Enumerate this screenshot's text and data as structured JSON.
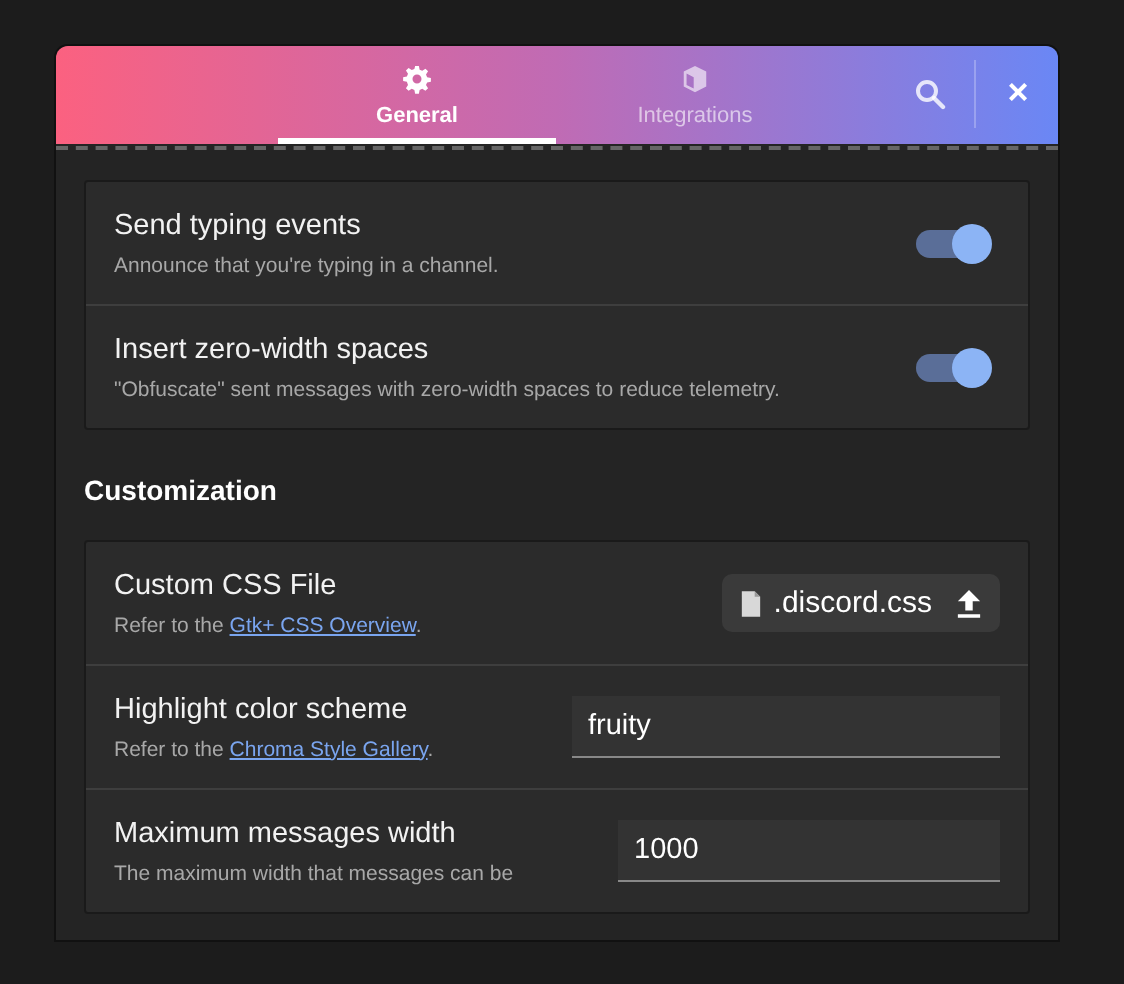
{
  "header": {
    "tabs": [
      {
        "label": "General",
        "selected": true
      },
      {
        "label": "Integrations",
        "selected": false
      }
    ],
    "close": "×"
  },
  "sections": [
    {
      "rows": [
        {
          "kind": "toggle",
          "title": "Send typing events",
          "description": {
            "text": "Announce that you're typing in a channel."
          },
          "on": true
        },
        {
          "kind": "toggle",
          "title": "Insert zero-width spaces",
          "description": {
            "text": "\"Obfuscate\" sent messages with zero-width spaces to reduce telemetry."
          },
          "on": true
        }
      ]
    },
    {
      "title": "Customization",
      "rows": [
        {
          "kind": "file",
          "title": "Custom CSS File",
          "description": {
            "text": "Refer to the ",
            "link": "Gtk+ CSS Overview",
            "after": "."
          },
          "value": ".discord.css"
        },
        {
          "kind": "entry",
          "title": "Highlight color scheme",
          "description": {
            "text": "Refer to the ",
            "link": "Chroma Style Gallery",
            "after": "."
          },
          "value": "fruity"
        },
        {
          "kind": "entry",
          "title": "Maximum messages width",
          "description": {
            "text": "The maximum width that messages can be"
          },
          "value": "1000"
        }
      ]
    }
  ]
}
